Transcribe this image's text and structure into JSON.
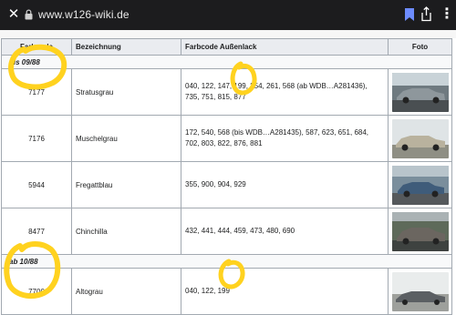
{
  "browser": {
    "url": "www.w126-wiki.de"
  },
  "table": {
    "headers": {
      "code": "Farbcode",
      "name": "Bezeichnung",
      "exterior": "Farbcode Außenlack",
      "photo": "Foto"
    },
    "groups": [
      {
        "label": "bis 09/88",
        "rows": [
          {
            "code": "7177",
            "name": "Stratusgrau",
            "exterior_line1": "040, 122, 147, 199, 254, 261, 568 (ab WDB…A281436),",
            "exterior_line2": "735, 751, 815, 877"
          },
          {
            "code": "7176",
            "name": "Muschelgrau",
            "exterior_line1": "172, 540, 568 (bis WDB…A281435), 587, 623, 651, 684,",
            "exterior_line2": "702, 803, 822, 876, 881"
          },
          {
            "code": "5944",
            "name": "Fregattblau",
            "exterior_line1": "355, 900, 904, 929",
            "exterior_line2": ""
          },
          {
            "code": "8477",
            "name": "Chinchilla",
            "exterior_line1": "432, 441, 444, 459, 473, 480, 690",
            "exterior_line2": ""
          }
        ]
      },
      {
        "label": "ab 10/88",
        "rows": [
          {
            "code": "7700",
            "name": "Altograu",
            "exterior_line1": "040, 122, 199",
            "exterior_line2": ""
          }
        ]
      }
    ]
  },
  "colors": {
    "topbar": "#1c1c1e",
    "header_bg": "#eaecf0",
    "border": "#a2a9b1",
    "highlighter": "#ffd21f",
    "bookmark": "#6d8cff"
  }
}
